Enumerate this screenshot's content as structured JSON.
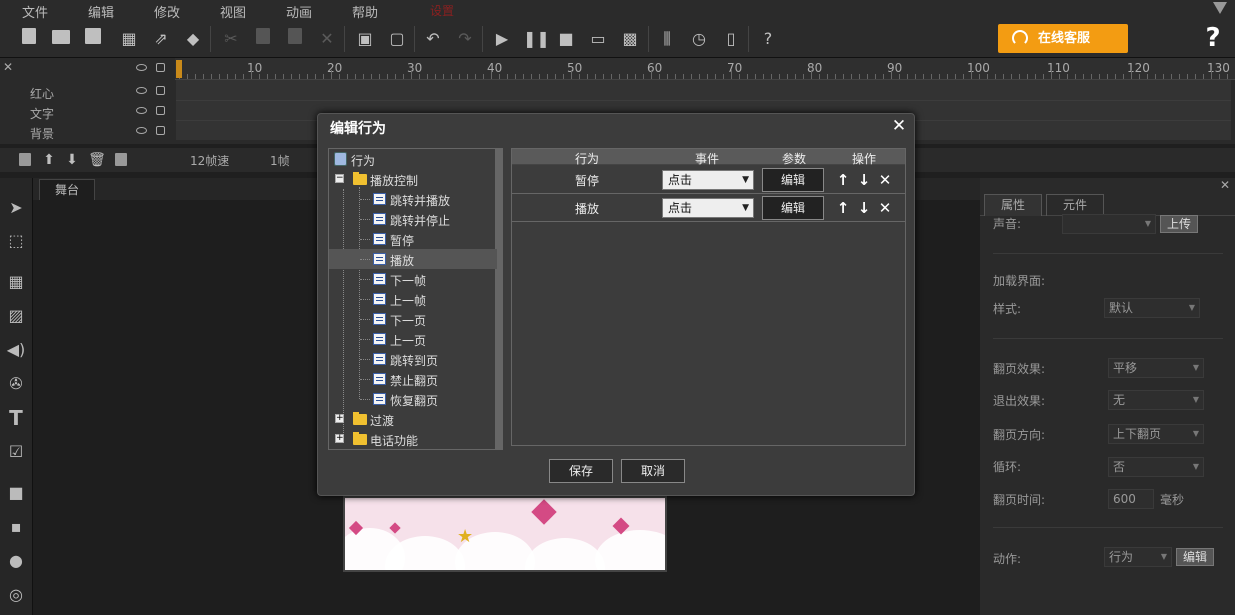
{
  "menu": {
    "items": [
      "文件",
      "编辑",
      "修改",
      "视图",
      "动画",
      "帮助"
    ],
    "extra": "设置"
  },
  "toolbar": {
    "service_label": "在线客服",
    "help_glyph": "?"
  },
  "timeline": {
    "ruler_numbers": [
      "10",
      "20",
      "30",
      "40",
      "50",
      "60",
      "70",
      "80",
      "90",
      "100",
      "110",
      "120",
      "130"
    ],
    "layers": [
      "红心",
      "文字",
      "背景"
    ],
    "fps": "12帧速",
    "frame": "1帧"
  },
  "stage": {
    "tab_label": "舞台"
  },
  "right_panel": {
    "tabs": [
      "属性",
      "元件"
    ],
    "sound_label": "声音:",
    "upload_label": "上传",
    "loading_label": "加载界面:",
    "style_label": "样式:",
    "style_value": "默认",
    "flip_effect_label": "翻页效果:",
    "flip_effect_value": "平移",
    "exit_effect_label": "退出效果:",
    "exit_effect_value": "无",
    "flip_dir_label": "翻页方向:",
    "flip_dir_value": "上下翻页",
    "loop_label": "循环:",
    "loop_value": "否",
    "flip_time_label": "翻页时间:",
    "flip_time_value": "600",
    "flip_time_unit": "毫秒",
    "action_label": "动作:",
    "action_value": "行为",
    "edit_label": "编辑"
  },
  "modal": {
    "title": "编辑行为",
    "tree": {
      "root": "行为",
      "group1": "播放控制",
      "group1_items": [
        "跳转并播放",
        "跳转并停止",
        "暂停",
        "播放",
        "下一帧",
        "上一帧",
        "下一页",
        "上一页",
        "跳转到页",
        "禁止翻页",
        "恢复翻页"
      ],
      "group2": "过渡",
      "group3": "电话功能"
    },
    "grid": {
      "headers": [
        "行为",
        "事件",
        "参数",
        "操作"
      ],
      "rows": [
        {
          "action": "暂停",
          "event": "点击",
          "param": "编辑"
        },
        {
          "action": "播放",
          "event": "点击",
          "param": "编辑"
        }
      ]
    },
    "save_label": "保存",
    "cancel_label": "取消"
  }
}
